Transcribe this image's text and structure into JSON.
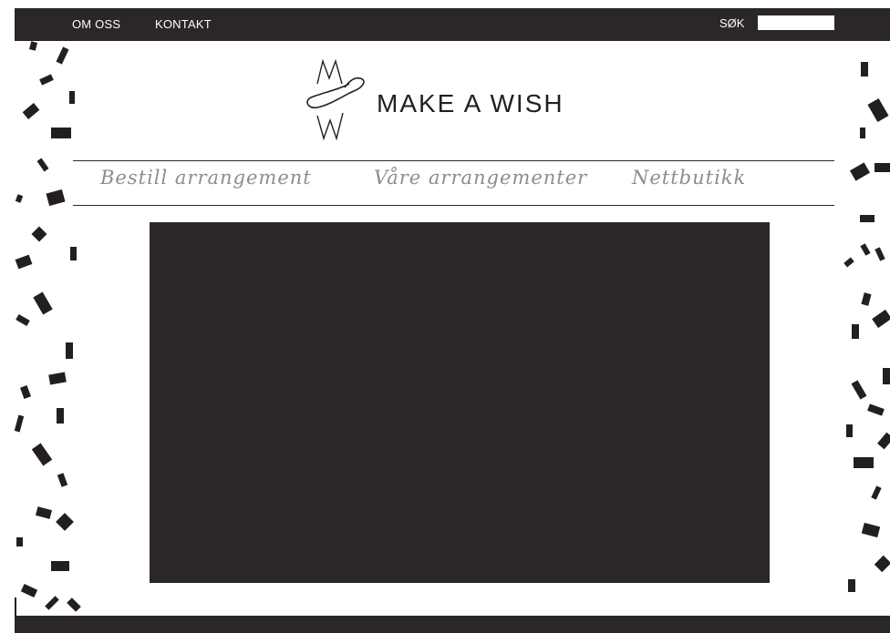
{
  "topbar": {
    "links": [
      "OM OSS",
      "KONTAKT"
    ],
    "search_label": "SØK",
    "search_value": ""
  },
  "header": {
    "logo_monogram": "MW",
    "brand_name": "MAKE A WISH"
  },
  "nav": {
    "items": [
      "Bestill arrangement",
      "Våre arrangementer",
      "Nettbutikk"
    ]
  },
  "colors": {
    "dark": "#2b2627",
    "nav_text": "#8d8d8d",
    "background": "#ffffff"
  }
}
